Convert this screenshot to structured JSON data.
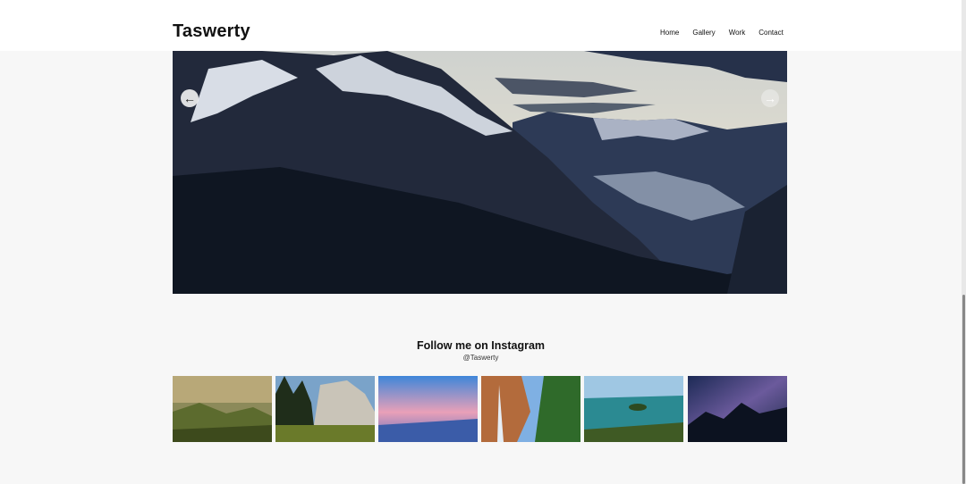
{
  "header": {
    "logo": "Taswerty",
    "nav": [
      "Home",
      "Gallery",
      "Work",
      "Contact"
    ]
  },
  "slider": {
    "prev_icon": "arrow-left-icon",
    "next_icon": "arrow-right-icon"
  },
  "instagram": {
    "title": "Follow me on Instagram",
    "handle": "@Taswerty"
  },
  "thumbnails": [
    "misty-hills-photo",
    "forest-cliff-photo",
    "sunset-beach-photo",
    "waterfall-canyon-photo",
    "lake-island-photo",
    "night-sky-mountains-photo"
  ],
  "colors": {
    "background": "#f7f7f7",
    "header": "#ffffff",
    "text": "#111111"
  }
}
